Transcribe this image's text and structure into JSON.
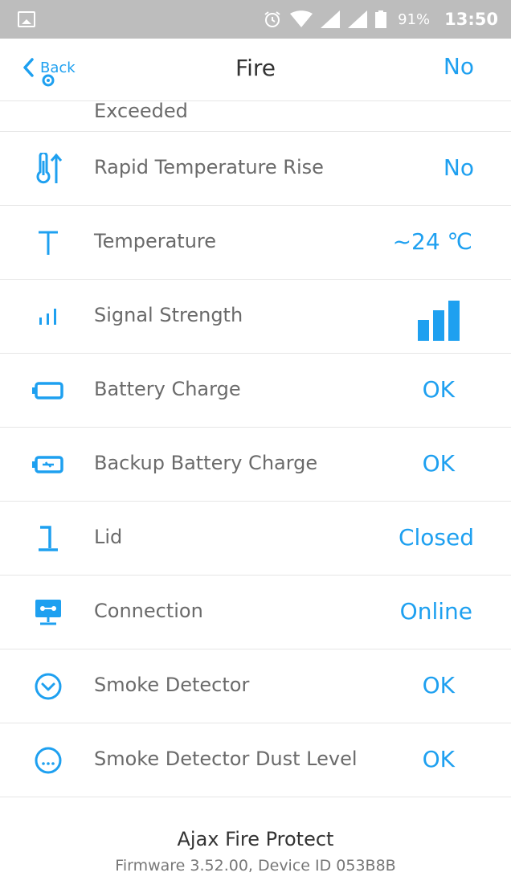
{
  "status_bar": {
    "battery_percent": "91%",
    "time": "13:50"
  },
  "nav": {
    "back_label": "Back",
    "title": "Fire"
  },
  "rows": [
    {
      "label": "Exceeded",
      "value": "No",
      "icon": "thermometer-drop-icon"
    },
    {
      "label": "Rapid Temperature Rise",
      "value": "No",
      "icon": "thermometer-rise-icon"
    },
    {
      "label": "Temperature",
      "value": "~24 ℃",
      "icon": "temperature-t-icon"
    },
    {
      "label": "Signal Strength",
      "value": null,
      "icon": "signal-strength-icon",
      "signal_level": 3,
      "signal_max": 3
    },
    {
      "label": "Battery Charge",
      "value": "OK",
      "icon": "battery-icon"
    },
    {
      "label": "Backup Battery Charge",
      "value": "OK",
      "icon": "backup-battery-icon"
    },
    {
      "label": "Lid",
      "value": "Closed",
      "icon": "lid-icon"
    },
    {
      "label": "Connection",
      "value": "Online",
      "icon": "connection-icon"
    },
    {
      "label": "Smoke Detector",
      "value": "OK",
      "icon": "smoke-detector-icon"
    },
    {
      "label": "Smoke Detector Dust Level",
      "value": "OK",
      "icon": "dust-level-icon"
    }
  ],
  "footer": {
    "device_name": "Ajax Fire Protect",
    "device_info": "Firmware 3.52.00, Device ID 053B8B"
  },
  "colors": {
    "accent": "#1ea0f0",
    "status_bar": "#bdbdbd",
    "separator": "#e6e6e6"
  }
}
